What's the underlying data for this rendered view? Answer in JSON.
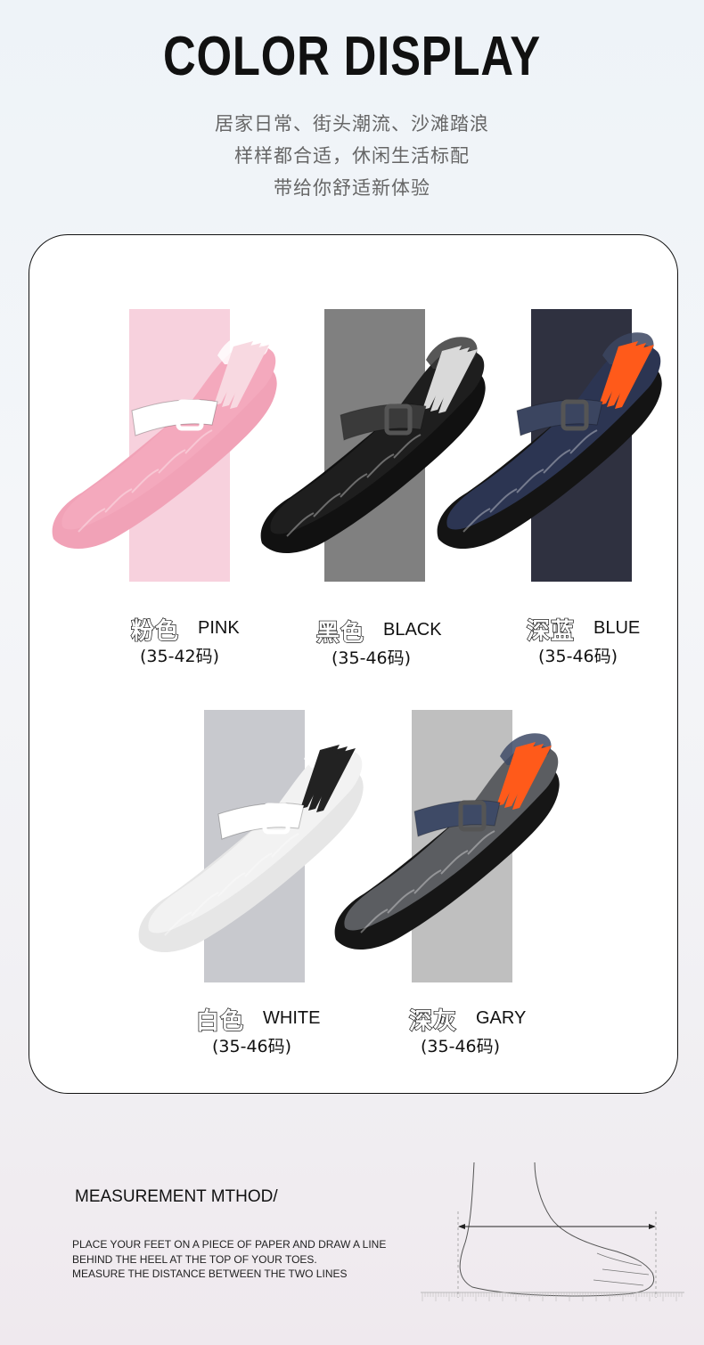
{
  "header": {
    "title": "COLOR DISPLAY",
    "lines": [
      "居家日常、街头潮流、沙滩踏浪",
      "样样都合适，休闲生活标配",
      "带给你舒适新体验"
    ]
  },
  "colors": [
    {
      "cn": "粉色",
      "en": "PINK",
      "size": "(35-42码)",
      "swatch": "#f7d1dd",
      "upper": "#f4a9bd",
      "sole": "#f1a2b7",
      "accent": "#ffffff",
      "stripe": "#f8d9e1"
    },
    {
      "cn": "黑色",
      "en": "BLACK",
      "size": "(35-46码)",
      "swatch": "#808080",
      "upper": "#1e1e1e",
      "sole": "#111111",
      "accent": "#3a3a3a",
      "stripe": "#d9d9d9"
    },
    {
      "cn": "深蓝",
      "en": "BLUE",
      "size": "(35-46码)",
      "swatch": "#2f3140",
      "upper": "#2c3552",
      "sole": "#141414",
      "accent": "#3b4560",
      "stripe": "#ff5a1a"
    },
    {
      "cn": "白色",
      "en": "WHITE",
      "size": "(35-46码)",
      "swatch": "#c8c9ce",
      "upper": "#f2f2f2",
      "sole": "#e6e6e6",
      "accent": "#ffffff",
      "stripe": "#222222"
    },
    {
      "cn": "深灰",
      "en": "GARY",
      "size": "(35-46码)",
      "swatch": "#bfbfbf",
      "upper": "#5b5d61",
      "sole": "#161616",
      "accent": "#3e4a66",
      "stripe": "#ff5a1a"
    }
  ],
  "measurement": {
    "title": "MEASUREMENT MTHOD/",
    "lines": [
      "PLACE YOUR FEET ON A PIECE OF PAPER AND DRAW A LINE",
      "BEHIND THE HEEL AT THE TOP OF YOUR TOES.",
      "MEASURE THE DISTANCE BETWEEN THE TWO LINES"
    ]
  }
}
